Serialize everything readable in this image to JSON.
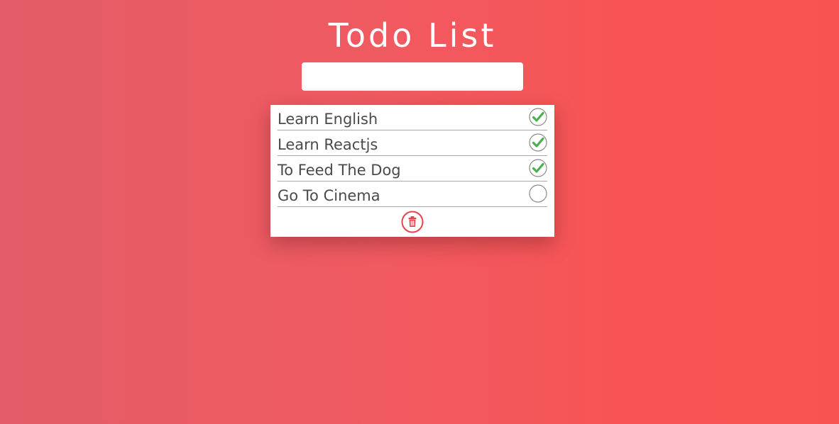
{
  "header": {
    "title": "Todo List"
  },
  "input": {
    "value": "",
    "placeholder": ""
  },
  "todos": [
    {
      "text": "Learn English",
      "done": true
    },
    {
      "text": "Learn Reactjs",
      "done": true
    },
    {
      "text": "To Feed The Dog",
      "done": true
    },
    {
      "text": "Go To Cinema",
      "done": false
    }
  ],
  "icons": {
    "done": "check-circle-icon",
    "pending": "empty-circle-icon",
    "clear": "trash-icon"
  },
  "colors": {
    "accent": "#f05a61",
    "done": "#4caf50",
    "trash": "#e8434c"
  }
}
